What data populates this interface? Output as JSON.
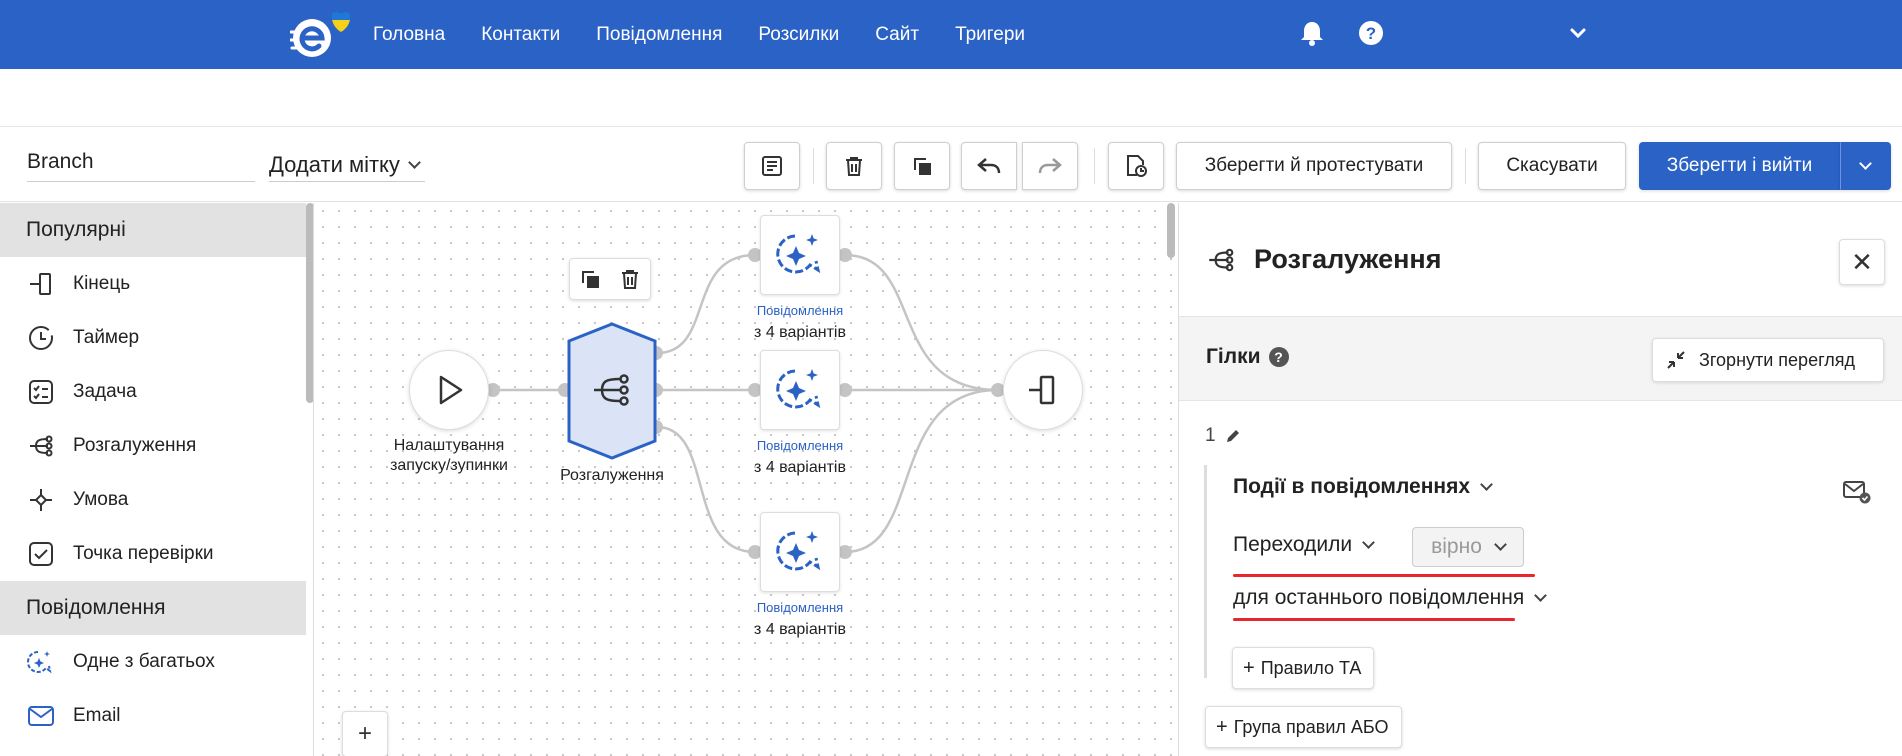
{
  "nav": {
    "items": [
      "Головна",
      "Контакти",
      "Повідомлення",
      "Розсилки",
      "Сайт",
      "Тригери"
    ]
  },
  "toolbar": {
    "flow_name": "Branch",
    "add_tag_label": "Додати мітку",
    "save_test_label": "Зберегти й протестувати",
    "cancel_label": "Скасувати",
    "save_exit_label": "Зберегти і вийти"
  },
  "sidebar": {
    "sections": [
      {
        "title": "Популярні",
        "items": [
          {
            "label": "Кінець",
            "icon": "end-icon"
          },
          {
            "label": "Таймер",
            "icon": "timer-icon"
          },
          {
            "label": "Задача",
            "icon": "task-icon"
          },
          {
            "label": "Розгалуження",
            "icon": "branch-icon"
          },
          {
            "label": "Умова",
            "icon": "condition-icon"
          },
          {
            "label": "Точка перевірки",
            "icon": "checkpoint-icon"
          }
        ]
      },
      {
        "title": "Повідомлення",
        "items": [
          {
            "label": "Одне з багатьох",
            "icon": "sparkle-icon"
          },
          {
            "label": "Email",
            "icon": "email-icon"
          }
        ]
      }
    ]
  },
  "canvas": {
    "start_label": "Налаштування запуску/зупинки",
    "branch_label": "Розгалуження",
    "messages": [
      {
        "type": "Повідомлення",
        "variants": "з 4 варіантів"
      },
      {
        "type": "Повідомлення",
        "variants": "з 4 варіантів"
      },
      {
        "type": "Повідомлення",
        "variants": "з 4 варіантів"
      }
    ],
    "zoom_in": "+"
  },
  "panel": {
    "title": "Розгалуження",
    "close": "✕",
    "branches_title": "Гілки",
    "help": "?",
    "collapse_label": "Згорнути перегляд",
    "rule_number": "1",
    "event_field": "Події в повідомленнях",
    "action_field": "Переходили",
    "value_pill": "вірно",
    "scope_field": "для останнього повідомлення",
    "add_rule_label": "Правило ТА",
    "add_group_label": "Група правил АБО"
  },
  "colors": {
    "brand": "#2b62c6",
    "highlight": "#e8262d",
    "branch_node_fill": "#dbe4f7"
  }
}
